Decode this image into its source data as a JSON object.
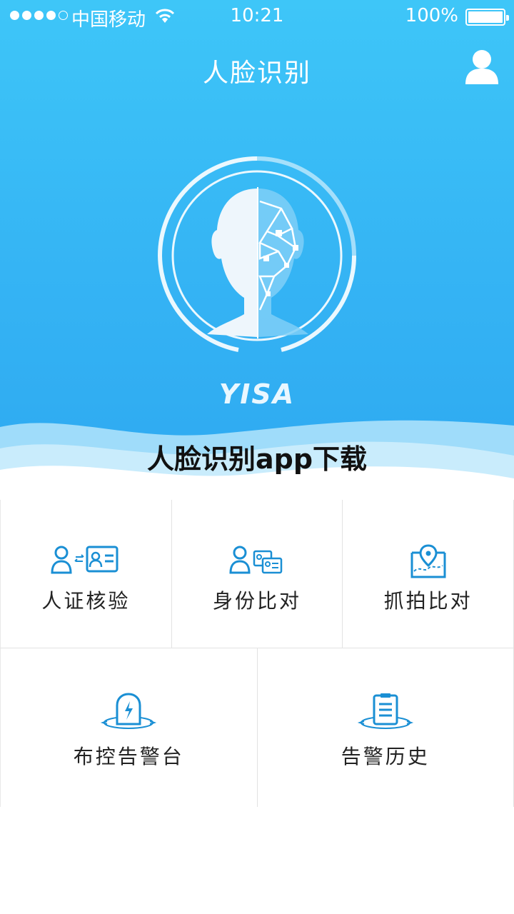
{
  "status_bar": {
    "carrier": "中国移动",
    "time": "10:21",
    "battery": "100%"
  },
  "header": {
    "title": "人脸识别"
  },
  "hero": {
    "logo": "YISA"
  },
  "watermark": "人脸识别app下载",
  "menu": {
    "row1": [
      {
        "label": "人证核验",
        "icon": "id-verify-icon"
      },
      {
        "label": "身份比对",
        "icon": "identity-compare-icon"
      },
      {
        "label": "抓拍比对",
        "icon": "capture-compare-icon"
      }
    ],
    "row2": [
      {
        "label": "布控告警台",
        "icon": "alarm-console-icon"
      },
      {
        "label": "告警历史",
        "icon": "alarm-history-icon"
      }
    ]
  },
  "colors": {
    "header_gradient_top": "#3ec6f8",
    "header_gradient_bottom": "#2ea9f1",
    "icon_blue": "#1a8fd4"
  }
}
